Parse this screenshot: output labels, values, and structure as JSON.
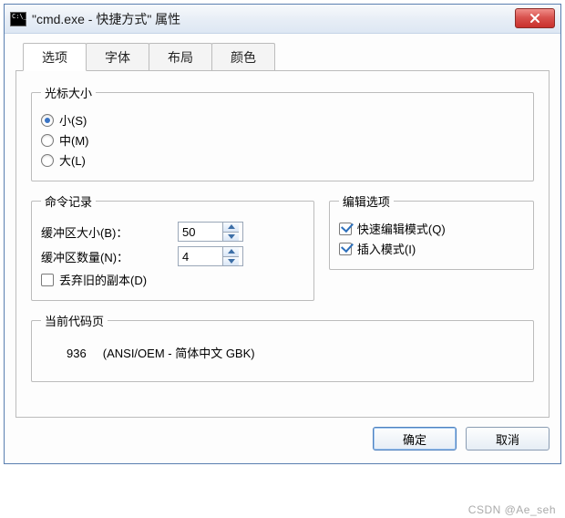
{
  "title": "\"cmd.exe - 快捷方式\" 属性",
  "tabs": [
    "选项",
    "字体",
    "布局",
    "颜色"
  ],
  "active_tab": 0,
  "cursor_size": {
    "legend": "光标大小",
    "options": [
      "小(S)",
      "中(M)",
      "大(L)"
    ],
    "selected": 0
  },
  "command_history": {
    "legend": "命令记录",
    "buffer_size_label": "缓冲区大小(B)：",
    "buffer_size_value": "50",
    "buffer_count_label": "缓冲区数量(N)：",
    "buffer_count_value": "4",
    "discard_old_label": "丢弃旧的副本(D)",
    "discard_old_checked": false
  },
  "edit_options": {
    "legend": "编辑选项",
    "quick_edit_label": "快速编辑模式(Q)",
    "quick_edit_checked": true,
    "insert_mode_label": "插入模式(I)",
    "insert_mode_checked": true
  },
  "code_page": {
    "legend": "当前代码页",
    "value": "936",
    "desc": "(ANSI/OEM - 简体中文 GBK)"
  },
  "buttons": {
    "ok": "确定",
    "cancel": "取消"
  },
  "watermark": "CSDN @Ae_seh"
}
